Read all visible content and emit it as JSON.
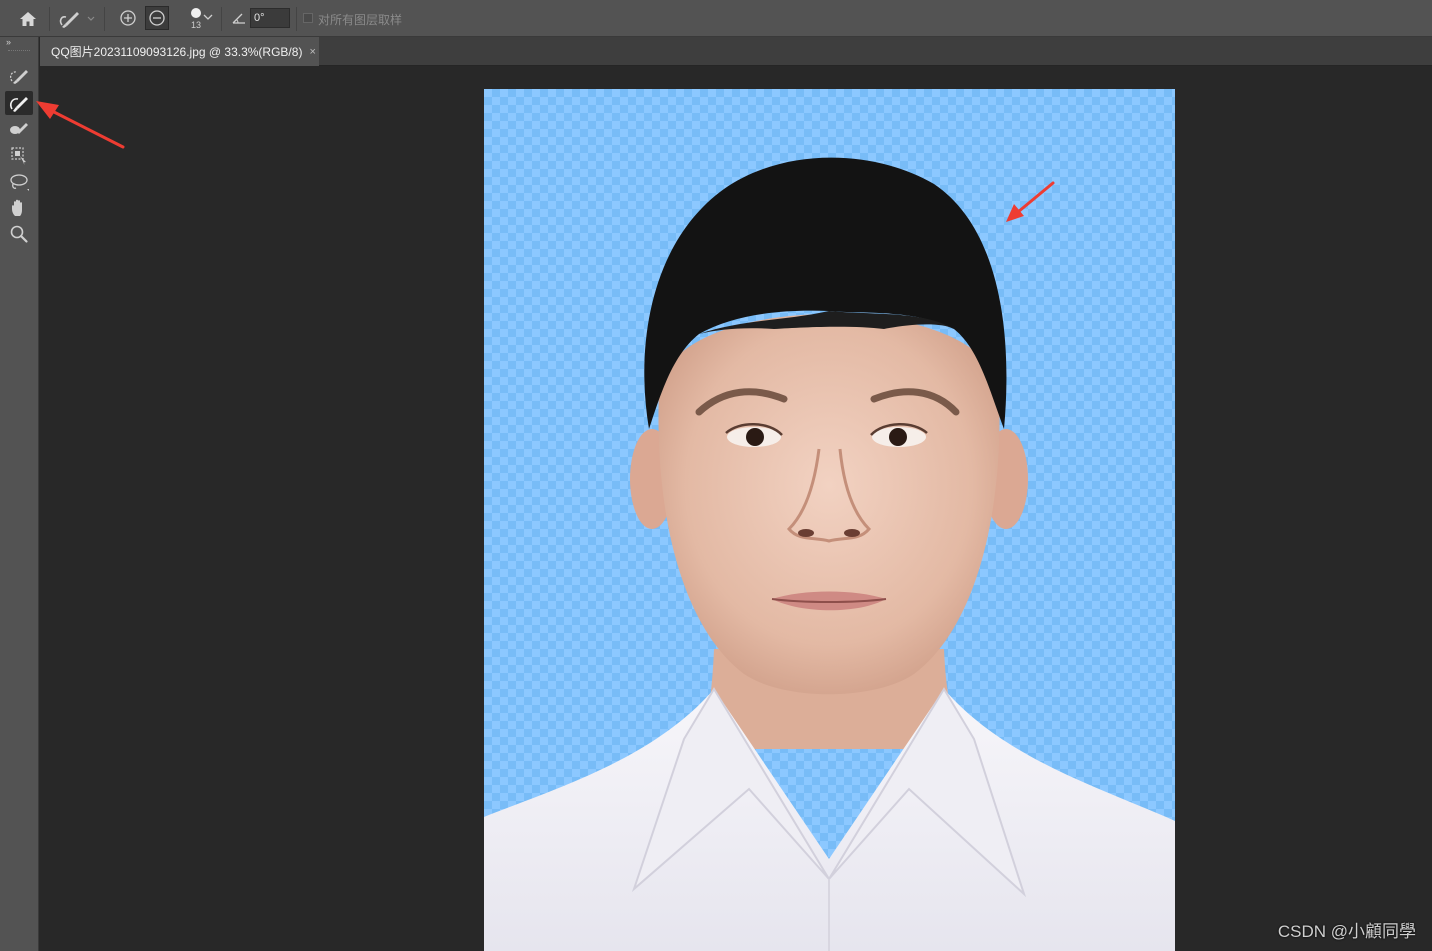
{
  "options_bar": {
    "home_icon": "home-icon",
    "tool_preset_icon": "brush-edge-icon",
    "add_mode_icon": "plus-circle-icon",
    "subtract_mode_icon": "minus-circle-icon",
    "brush_size": "13",
    "angle_icon": "angle-icon",
    "angle_value": "0°",
    "sample_all_layers_label": "对所有图层取样"
  },
  "toolbar": {
    "collapse_label": "››",
    "tools": [
      {
        "name": "quick-selection-brush-icon",
        "active": false
      },
      {
        "name": "refine-edge-brush-icon",
        "active": true
      },
      {
        "name": "brush-icon",
        "active": false
      },
      {
        "name": "object-selection-icon",
        "active": false
      },
      {
        "name": "lasso-icon",
        "active": false
      },
      {
        "name": "hand-icon",
        "active": false
      },
      {
        "name": "zoom-icon",
        "active": false
      }
    ]
  },
  "document_tab": {
    "title": "QQ图片20231109093126.jpg @ 33.3%(RGB/8)",
    "close": "×"
  },
  "colors": {
    "annotation_arrow": "#ee3c32",
    "transparency_checker": "#8cc8ff"
  },
  "watermark": "CSDN @小顧同學"
}
